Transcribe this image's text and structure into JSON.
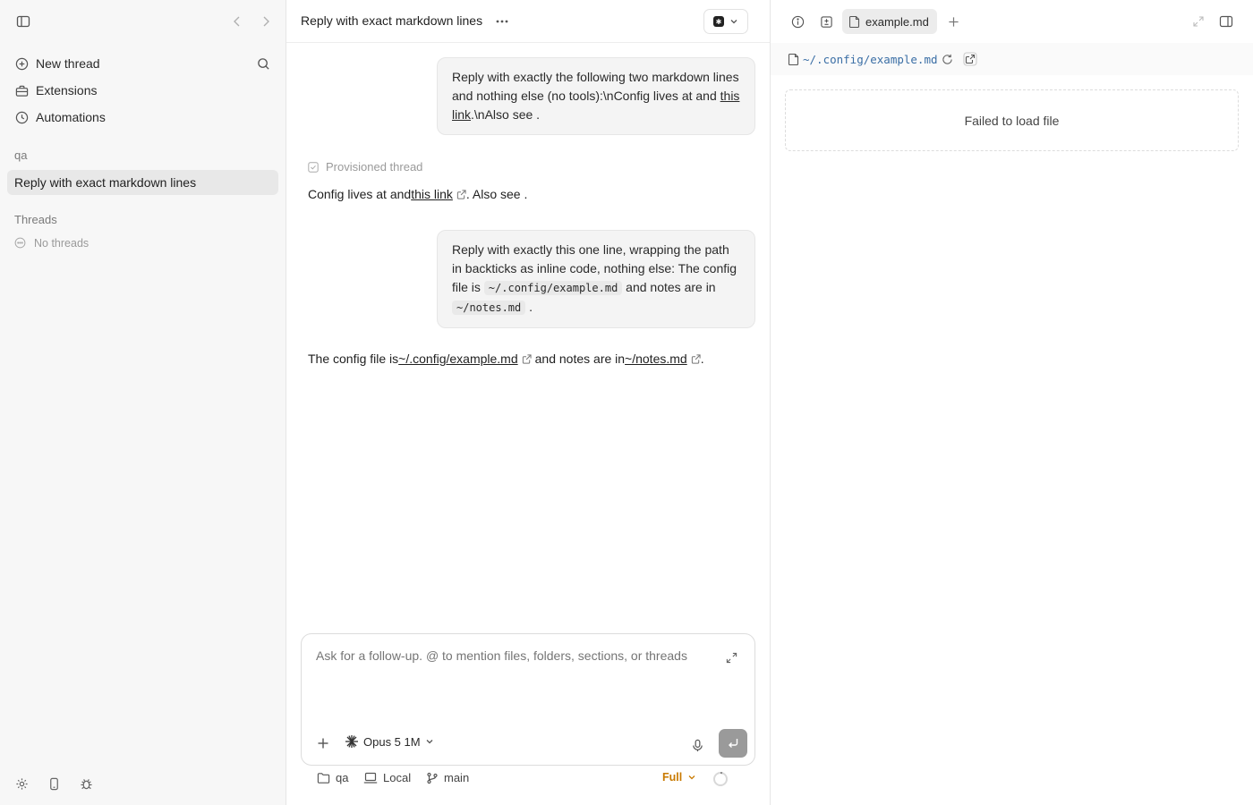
{
  "sidebar": {
    "nav": [
      {
        "label": "New thread",
        "icon": "plus-circle-icon"
      },
      {
        "label": "Extensions",
        "icon": "toolbox-icon"
      },
      {
        "label": "Automations",
        "icon": "clock-icon"
      }
    ],
    "project_label": "qa",
    "active_thread": "Reply with exact markdown lines",
    "threads_label": "Threads",
    "empty_threads": "No threads"
  },
  "chat": {
    "title": "Reply with exact markdown lines",
    "messages": {
      "user1": {
        "line1": "Reply with exactly the following two markdown lines and nothing else (no tools):\\nConfig lives at and ",
        "link": "this link",
        "line2": ".\\nAlso see ."
      },
      "provisioned": "Provisioned thread",
      "reply1": {
        "pre": "Config lives at and ",
        "link": "this link",
        "post": ". Also see ."
      },
      "user2": {
        "pre": "Reply with exactly this one line, wrapping the path in backticks as inline code, nothing else: The config file is ",
        "code1": "~/.config/example.md",
        "mid": " and notes are in ",
        "code2": "~/notes.md",
        "post": " ."
      },
      "reply2": {
        "pre": "The config file is ",
        "link1": "~/.config/example.md",
        "mid": " and notes are in ",
        "link2": "~/notes.md",
        "post": "."
      }
    },
    "composer": {
      "placeholder": "Ask for a follow-up. @ to mention files, folders, sections, or threads",
      "model": "Opus 5 1M"
    },
    "footer": {
      "folder": "qa",
      "environment": "Local",
      "branch": "main",
      "mode": "Full"
    }
  },
  "file_panel": {
    "tab_name": "example.md",
    "path": "~/.config/example.md",
    "error": "Failed to load file"
  },
  "colors": {
    "accent_orange": "#c97a00",
    "link_blue": "#3a6ea5",
    "sidebar_bg": "#f7f7f7"
  }
}
